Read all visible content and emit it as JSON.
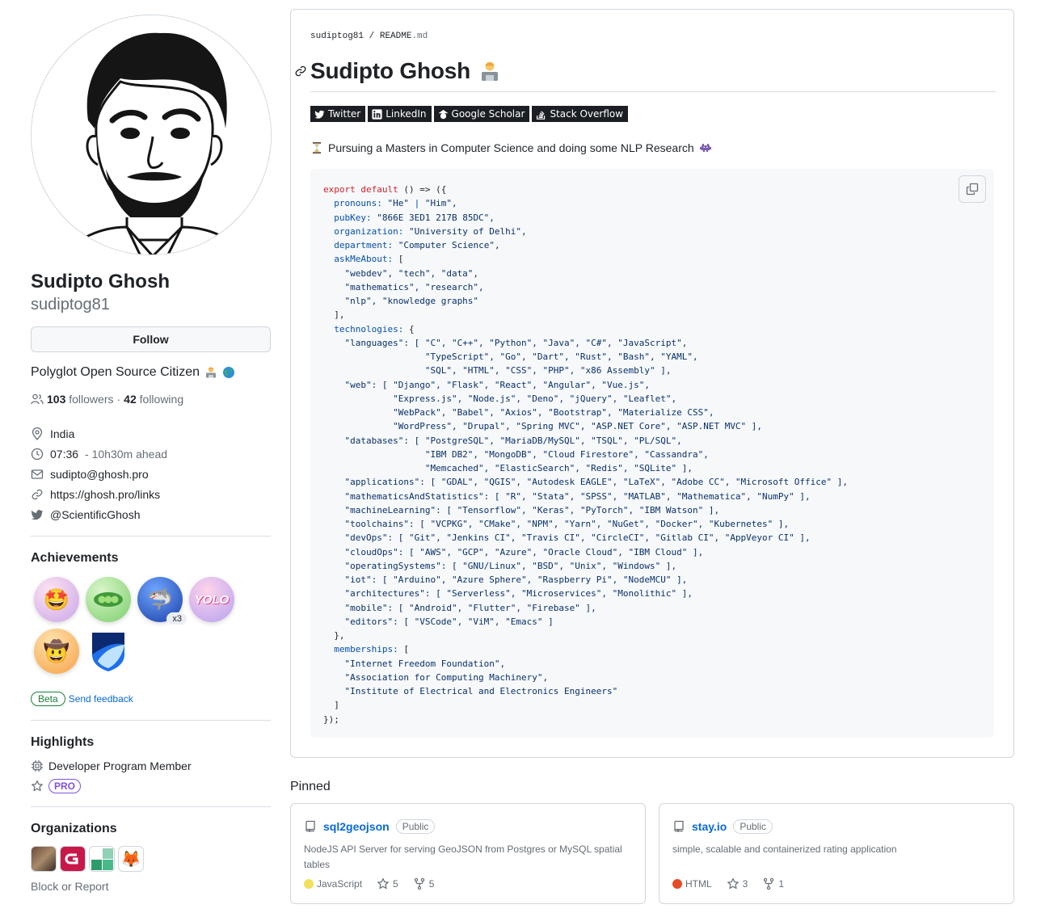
{
  "profile": {
    "name": "Sudipto Ghosh",
    "login": "sudiptog81",
    "follow_label": "Follow",
    "bio": "Polyglot Open Source Citizen",
    "followers_count": "103",
    "followers_label": "followers",
    "dot": "·",
    "following_count": "42",
    "following_label": "following",
    "location": "India",
    "time": "07:36",
    "time_delta": "- 10h30m ahead",
    "email": "sudipto@ghosh.pro",
    "website": "https://ghosh.pro/links",
    "twitter": "@ScientificGhosh"
  },
  "achievements": {
    "title": "Achievements",
    "badges": [
      {
        "icon": "starstruck-badge",
        "emoji": "🤩",
        "color": "#f5d0e6"
      },
      {
        "icon": "pair-extraordinaire-badge",
        "emoji": "🫛",
        "color": "#b9e6a8"
      },
      {
        "icon": "pull-shark-badge",
        "emoji": "🦈",
        "color": "#3b6fd9",
        "count": "x3"
      },
      {
        "icon": "yolo-badge",
        "emoji": "YOLO",
        "color": "#f7b0d6"
      },
      {
        "icon": "quickdraw-badge",
        "emoji": "🤠",
        "color": "#f9c56b"
      },
      {
        "icon": "arctic-code-vault-badge",
        "emoji": "",
        "color": "#1d5fd1"
      }
    ],
    "beta_label": "Beta",
    "feedback_label": "Send feedback"
  },
  "highlights": {
    "title": "Highlights",
    "developer_program": "Developer Program Member",
    "pro_label": "PRO"
  },
  "organizations": {
    "title": "Organizations",
    "block_label": "Block or Report"
  },
  "readme": {
    "crumb_user": "sudiptog81",
    "crumb_sep": "/",
    "crumb_file": "README",
    "crumb_ext": ".md",
    "heading": "Sudipto Ghosh",
    "shields": [
      {
        "label": "Twitter",
        "icon": "twitter-icon"
      },
      {
        "label": "LinkedIn",
        "icon": "linkedin-icon"
      },
      {
        "label": "Google Scholar",
        "icon": "google-scholar-icon"
      },
      {
        "label": "Stack Overflow",
        "icon": "stack-overflow-icon"
      }
    ],
    "pursuing": "Pursuing a Masters in Computer Science and doing some NLP Research"
  },
  "pinned": {
    "title": "Pinned",
    "repos": [
      {
        "name": "sql2geojson",
        "visibility": "Public",
        "description": "NodeJS API Server for serving GeoJSON from Postgres or MySQL spatial tables",
        "language": "JavaScript",
        "language_color": "#f1e05a",
        "stars": "5",
        "forks": "5"
      },
      {
        "name": "stay.io",
        "visibility": "Public",
        "description": "simple, scalable and containerized rating application",
        "language": "HTML",
        "language_color": "#e34c26",
        "stars": "3",
        "forks": "1"
      }
    ]
  }
}
